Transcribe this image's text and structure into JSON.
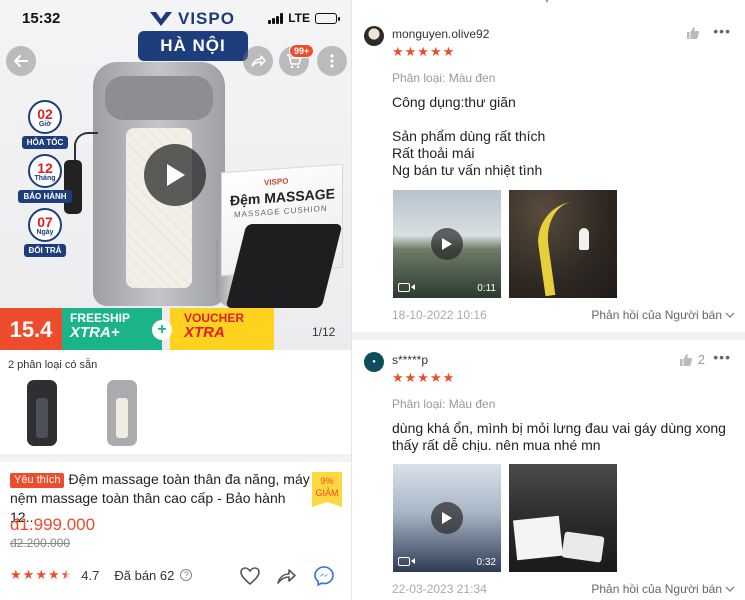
{
  "status_bar": {
    "time": "15:32",
    "network": "LTE"
  },
  "product_hero": {
    "brand": "VISPO",
    "city_label": "HÀ NỘI",
    "cart_count": "99+",
    "badges": [
      {
        "num": "02",
        "unit": "Giờ",
        "label": "HỎA TỐC"
      },
      {
        "num": "12",
        "unit": "Tháng",
        "label": "BẢO HÀNH"
      },
      {
        "num": "07",
        "unit": "Ngày",
        "label": "ĐỔI TRẢ"
      }
    ],
    "box_logo": "VISPO",
    "box_title": "Đệm MASSAGE",
    "box_subtitle": "MASSAGE CUSHION",
    "promo_date": "15.4",
    "promo_freeship": "FREESHIP",
    "promo_freeship_sub": "XTRA+",
    "promo_voucher": "VOUCHER",
    "promo_voucher_sub": "XTRA",
    "image_counter": "1/12"
  },
  "variants": {
    "label": "2 phân loại có sẵn"
  },
  "product_info": {
    "favorite_tag": "Yêu thích",
    "title": "Đệm massage toàn thân đa năng, máy nệm massage toàn thân cao cấp - Bảo hành 12...",
    "discount_percent": "9%",
    "discount_label": "GIẢM",
    "price": "đ1.999.000",
    "old_price": "đ2.200.000",
    "rating": "4.7",
    "rating_stars": 4.5,
    "sold": "Đã bán 62"
  },
  "reviews": [
    {
      "username": "monguyen.olive92",
      "stars": "★★★★★",
      "likes": "",
      "variant": "Phân loại: Màu đen",
      "text": "Công dụng:thư giãn\n\nSản phẩm dùng rất thích\nRất thoải mái\nNg bán tư vấn nhiệt tình",
      "video_duration": "0:11",
      "date": "18-10-2022 10:16",
      "seller_reply": "Phản hồi của Người bán"
    },
    {
      "username": "s*****p",
      "stars": "★★★★★",
      "likes": "2",
      "variant": "Phân loại: Màu đen",
      "text": "dùng khá ổn, mình bị mỏi lưng đau vai gáy dùng xong thấy rất dễ chịu. nên mua nhé mn",
      "video_duration": "0:32",
      "date": "22-03-2023 21:34",
      "seller_reply": "Phản hồi của Người bán"
    }
  ],
  "colors": {
    "accent": "#ee4d2d",
    "brand_blue": "#1d3d7c",
    "freeship_green": "#1ab38a",
    "voucher_yellow": "#ffd21f"
  }
}
